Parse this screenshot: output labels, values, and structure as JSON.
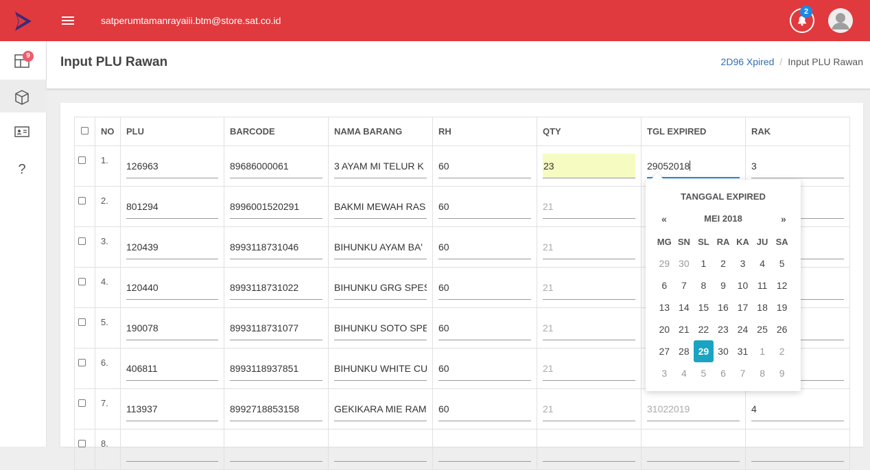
{
  "header": {
    "user_email": "satperumtamanrayaiii.btm@store.sat.co.id",
    "notification_count": "2",
    "accent_color": "#e03a3e"
  },
  "sidebar": {
    "items": [
      {
        "icon": "dashboard-icon",
        "badge": "9"
      },
      {
        "icon": "box-icon"
      },
      {
        "icon": "id-card-icon"
      },
      {
        "icon": "help-icon"
      }
    ]
  },
  "page": {
    "title": "Input PLU Rawan",
    "breadcrumb": [
      {
        "label": "2D96 Xpired"
      },
      {
        "label": "Input PLU Rawan"
      }
    ]
  },
  "table": {
    "headers": {
      "no": "NO",
      "plu": "PLU",
      "barcode": "BARCODE",
      "nama": "NAMA BARANG",
      "rh": "RH",
      "qty": "QTY",
      "tgl": "TGL EXPIRED",
      "rak": "RAK"
    },
    "rows": [
      {
        "no": "1.",
        "plu": "126963",
        "barcode": "89686000061",
        "nama": "3 AYAM MI TELUR K",
        "rh": "60",
        "qty": "23",
        "tgl": "29052018",
        "rak": "3"
      },
      {
        "no": "2.",
        "plu": "801294",
        "barcode": "8996001520291",
        "nama": "BAKMI MEWAH RAS",
        "rh": "60",
        "qty": "21",
        "tgl": "",
        "rak": ""
      },
      {
        "no": "3.",
        "plu": "120439",
        "barcode": "8993118731046",
        "nama": "BIHUNKU AYAM BA'",
        "rh": "60",
        "qty": "21",
        "tgl": "",
        "rak": ""
      },
      {
        "no": "4.",
        "plu": "120440",
        "barcode": "8993118731022",
        "nama": "BIHUNKU GRG SPES",
        "rh": "60",
        "qty": "21",
        "tgl": "",
        "rak": ""
      },
      {
        "no": "5.",
        "plu": "190078",
        "barcode": "8993118731077",
        "nama": "BIHUNKU SOTO SPE",
        "rh": "60",
        "qty": "21",
        "tgl": "",
        "rak": ""
      },
      {
        "no": "6.",
        "plu": "406811",
        "barcode": "8993118937851",
        "nama": "BIHUNKU WHITE CU",
        "rh": "60",
        "qty": "21",
        "tgl": "",
        "rak": ""
      },
      {
        "no": "7.",
        "plu": "113937",
        "barcode": "8992718853158",
        "nama": "GEKIKARA MIE RAM",
        "rh": "60",
        "qty": "21",
        "tgl": "31022019",
        "rak": "4"
      },
      {
        "no": "8.",
        "plu": "",
        "barcode": "",
        "nama": "",
        "rh": "",
        "qty": "",
        "tgl": "",
        "rak": ""
      }
    ]
  },
  "datepicker": {
    "title": "TANGGAL EXPIRED",
    "prev": "«",
    "next": "»",
    "month": "MEI 2018",
    "weekdays": [
      "MG",
      "SN",
      "SL",
      "RA",
      "KA",
      "JU",
      "SA"
    ],
    "weeks": [
      [
        "29",
        "30",
        "1",
        "2",
        "3",
        "4",
        "5"
      ],
      [
        "6",
        "7",
        "8",
        "9",
        "10",
        "11",
        "12"
      ],
      [
        "13",
        "14",
        "15",
        "16",
        "17",
        "18",
        "19"
      ],
      [
        "20",
        "21",
        "22",
        "23",
        "24",
        "25",
        "26"
      ],
      [
        "27",
        "28",
        "29",
        "30",
        "31",
        "1",
        "2"
      ],
      [
        "3",
        "4",
        "5",
        "6",
        "7",
        "8",
        "9"
      ]
    ],
    "selected_day": "29",
    "selected_color": "#1aa3c2"
  }
}
